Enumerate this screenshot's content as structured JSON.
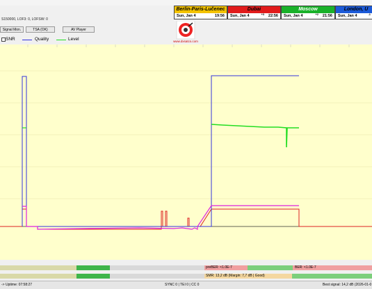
{
  "params_line": "S150000, LOF3: 0, LOFSW: 0",
  "clocks": [
    {
      "city": "Berlin-Paris-Lučenec",
      "day": "Sun, Jan 4",
      "time": "19:56",
      "offset": "",
      "bg": "#f3c200",
      "fg": "#000000"
    },
    {
      "city": "Dubai",
      "day": "Sun, Jan 4",
      "time": "22:56",
      "offset": "+3",
      "bg": "#e11b1b",
      "fg": "#000000"
    },
    {
      "city": "Moscow",
      "day": "Sun, Jan 4",
      "time": "21:56",
      "offset": "+2",
      "bg": "#19b12a",
      "fg": "#ffffff"
    },
    {
      "city": "London, U",
      "day": "Sun, Jan 4",
      "time": "1",
      "offset": "-1",
      "bg": "#1c5ad8",
      "fg": "#000000"
    }
  ],
  "buttons": {
    "signal_mon": "Signal Mon.",
    "tsa": "TSA (OK)",
    "av_player": "AV Player"
  },
  "logo_text": "www.dxsatcs.com",
  "legend": {
    "snr": "SNR",
    "quality": "Quality",
    "level": "Level"
  },
  "colors": {
    "plot_bg": "#ffffcc",
    "quality": "#3333dd",
    "level": "#22dd22",
    "snr": "#dd2222",
    "magenta": "#dd22dd"
  },
  "bars": {
    "prober": "preBER: <1.0E-7",
    "ber": "BER: <1.0E-7",
    "smr": "SMR: 13,2 dB (Margin: 7,7 dB | Good)"
  },
  "status": {
    "uptime": "-> Uptime: 07:58:27",
    "sync": "SYNC 0 | TEI 0 | CC 0",
    "best": "Best signal: 14,2 dB (2026-01-0"
  }
}
